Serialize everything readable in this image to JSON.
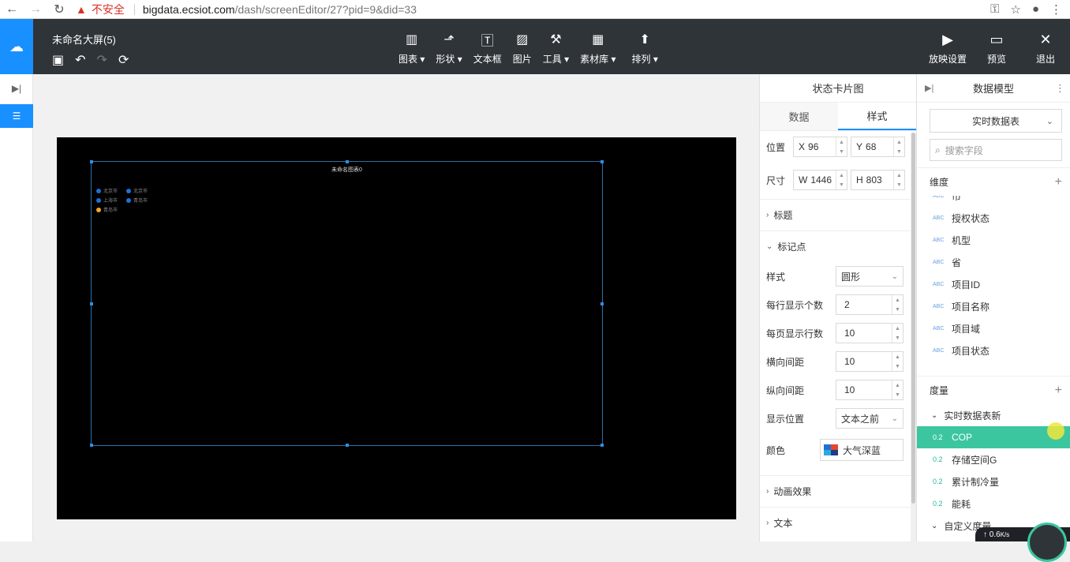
{
  "browser": {
    "insecure_label": "不安全",
    "url_host": "bigdata.ecsiot.com",
    "url_path": "/dash/screenEditor/27?pid=9&did=33"
  },
  "header": {
    "doc_title": "未命名大屏(5)",
    "tools": [
      {
        "label": "图表",
        "icon": "bar-chart-icon",
        "dropdown": true
      },
      {
        "label": "形状",
        "icon": "shape-icon",
        "dropdown": true
      },
      {
        "label": "文本框",
        "icon": "textbox-icon",
        "dropdown": false
      },
      {
        "label": "图片",
        "icon": "image-icon",
        "dropdown": false
      },
      {
        "label": "工具",
        "icon": "hammer-icon",
        "dropdown": true
      },
      {
        "label": "素材库",
        "icon": "library-icon",
        "dropdown": true
      },
      {
        "label": "排列",
        "icon": "arrange-icon",
        "dropdown": true
      }
    ],
    "right_tools": [
      {
        "label": "放映设置",
        "icon": "play-screen-icon"
      },
      {
        "label": "预览",
        "icon": "preview-icon"
      },
      {
        "label": "退出",
        "icon": "close-icon"
      }
    ]
  },
  "canvas": {
    "widget_title": "未命名图表0",
    "legend": [
      {
        "label": "北京市",
        "color": "#1f6fd6"
      },
      {
        "label": "北京市",
        "color": "#1f6fd6"
      },
      {
        "label": "上海市",
        "color": "#1f6fd6"
      },
      {
        "label": "青岛市",
        "color": "#1f6fd6"
      },
      {
        "label": "青岛市",
        "color": "#f5a623"
      }
    ]
  },
  "style_panel": {
    "title": "状态卡片图",
    "tabs": [
      "数据",
      "样式"
    ],
    "active_tab": "样式",
    "position": {
      "label": "位置",
      "x_prefix": "X",
      "x": "96",
      "y_prefix": "Y",
      "y": "68"
    },
    "size": {
      "label": "尺寸",
      "w_prefix": "W",
      "w": "1446",
      "h_prefix": "H",
      "h": "803"
    },
    "section_title": "标题",
    "section_marker": "标记点",
    "marker": {
      "style_label": "样式",
      "style_value": "圆形",
      "per_row_label": "每行显示个数",
      "per_row_value": "2",
      "per_page_label": "每页显示行数",
      "per_page_value": "10",
      "h_gap_label": "横向间距",
      "h_gap_value": "10",
      "v_gap_label": "纵向间距",
      "v_gap_value": "10",
      "display_pos_label": "显示位置",
      "display_pos_value": "文本之前",
      "color_label": "颜色",
      "color_value": "大气深蓝"
    },
    "section_animation": "动画效果",
    "section_text": "文本"
  },
  "model_panel": {
    "title": "数据模型",
    "table_select": "实时数据表",
    "search_placeholder": "搜索字段",
    "dimension_label": "维度",
    "dimensions": [
      {
        "type": "ABC",
        "name": "市"
      },
      {
        "type": "ABC",
        "name": "授权状态"
      },
      {
        "type": "ABC",
        "name": "机型"
      },
      {
        "type": "ABC",
        "name": "省"
      },
      {
        "type": "ABC",
        "name": "项目ID"
      },
      {
        "type": "ABC",
        "name": "项目名称"
      },
      {
        "type": "ABC",
        "name": "项目域"
      },
      {
        "type": "ABC",
        "name": "项目状态"
      }
    ],
    "measure_label": "度量",
    "measure_group_1": "实时数据表新",
    "measures": [
      {
        "type": "0.2",
        "name": "COP",
        "active": true
      },
      {
        "type": "0.2",
        "name": "存储空间G",
        "active": false
      },
      {
        "type": "0.2",
        "name": "累计制冷量",
        "active": false
      },
      {
        "type": "0.2",
        "name": "能耗",
        "active": false
      }
    ],
    "measure_group_2": "自定义度量"
  },
  "net": {
    "speed": "0.6",
    "unit": "K/s"
  }
}
